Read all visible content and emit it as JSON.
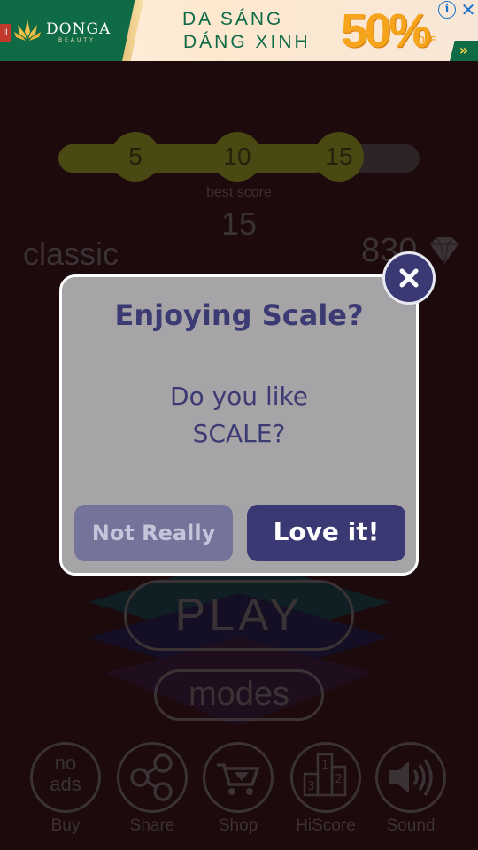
{
  "ad": {
    "pause_glyph": "II",
    "brand": "DONGA",
    "brand_sub": "BEAUTY",
    "line1": "DA SÁNG",
    "line2": "DÁNG XINH",
    "promo": "50%",
    "promo_off": "OFF",
    "info_glyph": "i",
    "close_glyph": "✕",
    "next_glyph": "»"
  },
  "game": {
    "progress": {
      "current": 15,
      "max": 20
    },
    "milestones": [
      "5",
      "10",
      "15"
    ],
    "best_score_label": "best score",
    "best_score": "15",
    "mode": "classic",
    "gems": "830",
    "play_label": "PLAY",
    "modes_label": "modes"
  },
  "bottom_bar": {
    "buy": {
      "icon_text": "no\nads",
      "label": "Buy"
    },
    "share": {
      "label": "Share"
    },
    "shop": {
      "label": "Shop"
    },
    "hiscore": {
      "label": "HiScore"
    },
    "sound": {
      "label": "Sound"
    }
  },
  "dialog": {
    "title": "Enjoying Scale?",
    "message_line1": "Do you like",
    "message_line2": "SCALE?",
    "not_really_label": "Not Really",
    "love_it_label": "Love it!"
  },
  "colors": {
    "background": "#1c0a0c",
    "dialog_bg": "#a7a4a8",
    "accent": "#3b3974",
    "ad_green": "#0f6a46",
    "ad_orange": "#f5a41c"
  }
}
